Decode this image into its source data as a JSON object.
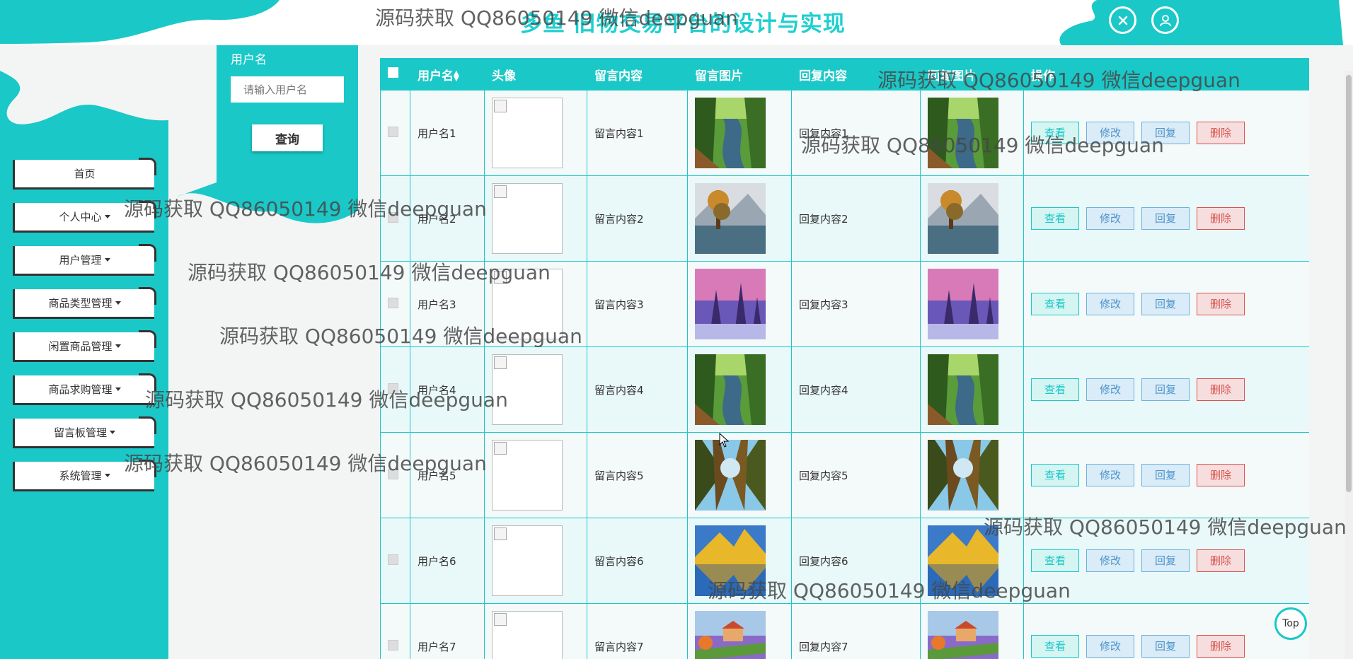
{
  "header": {
    "title": "多鱼 旧物交易平台的设计与实现",
    "accent_color": "#1bc8c8",
    "close_icon": "close-icon",
    "user_icon": "user-icon"
  },
  "nav": {
    "items": [
      {
        "label": "首页",
        "has_dropdown": false
      },
      {
        "label": "个人中心",
        "has_dropdown": true
      },
      {
        "label": "用户管理",
        "has_dropdown": true
      },
      {
        "label": "商品类型管理",
        "has_dropdown": true
      },
      {
        "label": "闲置商品管理",
        "has_dropdown": true
      },
      {
        "label": "商品求购管理",
        "has_dropdown": true
      },
      {
        "label": "留言板管理",
        "has_dropdown": true
      },
      {
        "label": "系统管理",
        "has_dropdown": true
      }
    ]
  },
  "search": {
    "label": "用户名",
    "placeholder": "请输入用户名",
    "button": "查询"
  },
  "table": {
    "columns": [
      "用户名",
      "头像",
      "留言内容",
      "留言图片",
      "回复内容",
      "回复图片",
      "操作"
    ],
    "sort_icon": "sort-icon",
    "actions": {
      "view": "查看",
      "edit": "修改",
      "reply": "回复",
      "delete": "删除"
    },
    "rows": [
      {
        "username": "用户名1",
        "content": "留言内容1",
        "reply": "回复内容1",
        "image": "river-forest"
      },
      {
        "username": "用户名2",
        "content": "留言内容2",
        "reply": "回复内容2",
        "image": "lake-tree-mountain"
      },
      {
        "username": "用户名3",
        "content": "留言内容3",
        "reply": "回复内容3",
        "image": "purple-snow-forest"
      },
      {
        "username": "用户名4",
        "content": "留言内容4",
        "reply": "回复内容4",
        "image": "river-forest"
      },
      {
        "username": "用户名5",
        "content": "留言内容5",
        "reply": "回复内容5",
        "image": "tall-trees-sky"
      },
      {
        "username": "用户名6",
        "content": "留言内容6",
        "reply": "回复内容6",
        "image": "golden-mountain-lake"
      },
      {
        "username": "用户名7",
        "content": "留言内容7",
        "reply": "回复内容7",
        "image": "lavender-field"
      }
    ]
  },
  "watermarks": [
    "源码获取 QQ86050149 微信deepguan",
    "源码获取 QQ86050149 微信deepguan",
    "源码获取 QQ86050149 微信deepguan",
    "源码获取 QQ86050149 微信deepguan",
    "源码获取 QQ86050149 微信deepguan",
    "源码获取 QQ86050149 微信deepguan",
    "源码获取 QQ86050149 微信deepguan",
    "源码获取 QQ86050149 微信deepguan",
    "源码获取 QQ86050149 微信deepguan",
    "源码获取 QQ86050149 微信deepguan"
  ],
  "back_to_top": "Top"
}
